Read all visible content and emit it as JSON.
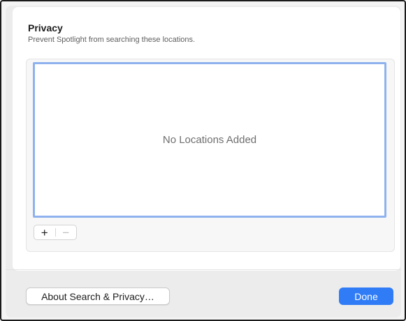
{
  "privacy": {
    "title": "Privacy",
    "subtitle": "Prevent Spotlight from searching these locations."
  },
  "locations": {
    "empty_text": "No Locations Added",
    "items": [],
    "add_label": "+",
    "remove_label": "−"
  },
  "footer": {
    "about_label": "About Search & Privacy…",
    "done_label": "Done"
  },
  "colors": {
    "accent": "#2f7cf6",
    "focus_ring": "#8fb2ee"
  }
}
